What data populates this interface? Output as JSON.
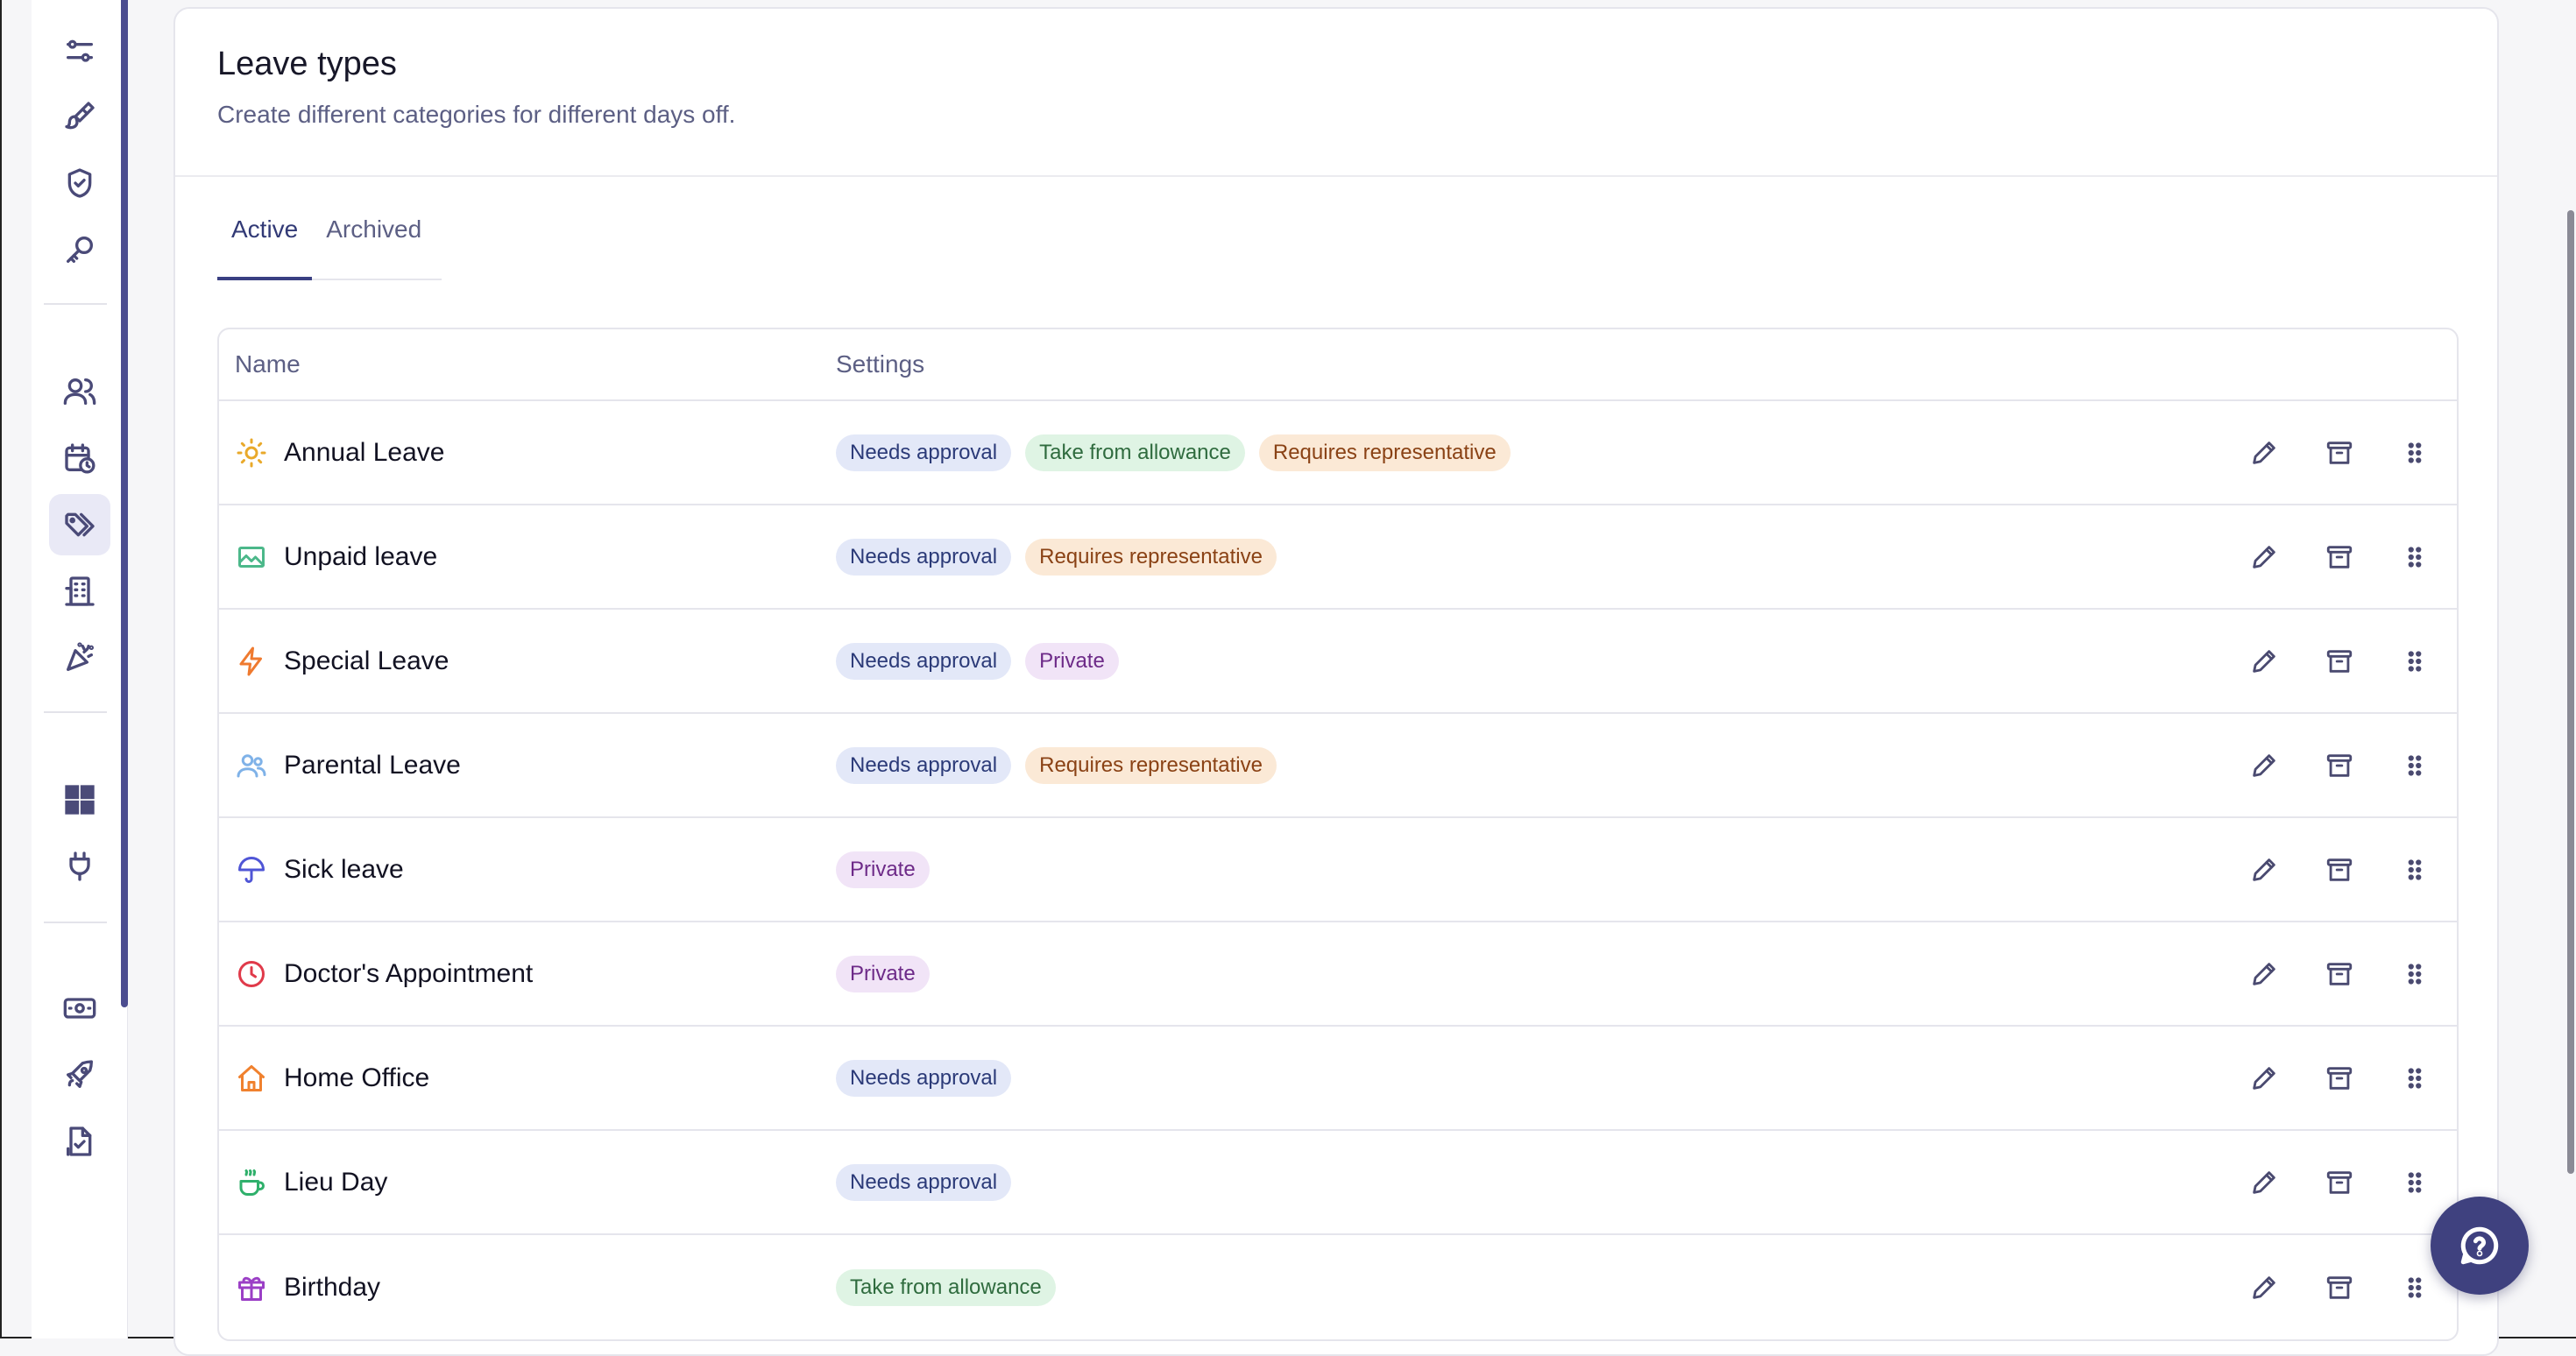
{
  "header": {
    "title": "Leave types",
    "subtitle": "Create different categories for different days off."
  },
  "tabs": [
    {
      "label": "Active",
      "active": true
    },
    {
      "label": "Archived",
      "active": false
    }
  ],
  "table": {
    "columns": {
      "name": "Name",
      "settings": "Settings"
    },
    "rows": [
      {
        "name": "Annual Leave",
        "icon": "sun-icon",
        "color": "#e9a92a",
        "badges": [
          "Needs approval",
          "Take from allowance",
          "Requires representative"
        ]
      },
      {
        "name": "Unpaid leave",
        "icon": "image-icon",
        "color": "#4cb88a",
        "badges": [
          "Needs approval",
          "Requires representative"
        ]
      },
      {
        "name": "Special Leave",
        "icon": "lightning-icon",
        "color": "#ef7a2f",
        "badges": [
          "Needs approval",
          "Private"
        ]
      },
      {
        "name": "Parental Leave",
        "icon": "people-icon",
        "color": "#7fb2e8",
        "badges": [
          "Needs approval",
          "Requires representative"
        ]
      },
      {
        "name": "Sick leave",
        "icon": "umbrella-icon",
        "color": "#4f55d6",
        "badges": [
          "Private"
        ]
      },
      {
        "name": "Doctor's Appointment",
        "icon": "clock-icon",
        "color": "#e03a4a",
        "badges": [
          "Private"
        ]
      },
      {
        "name": "Home Office",
        "icon": "house-icon",
        "color": "#f0812e",
        "badges": [
          "Needs approval"
        ]
      },
      {
        "name": "Lieu Day",
        "icon": "coffee-cup-icon",
        "color": "#2fb06b",
        "badges": [
          "Needs approval"
        ]
      },
      {
        "name": "Birthday",
        "icon": "gift-icon",
        "color": "#9b3fc6",
        "badges": [
          "Take from allowance"
        ]
      }
    ]
  },
  "badge_styles": {
    "Needs approval": "approval",
    "Take from allowance": "allowance",
    "Requires representative": "representative",
    "Private": "private"
  },
  "sidebar": {
    "items": [
      {
        "icon": "sliders-icon"
      },
      {
        "icon": "paintbrush-icon"
      },
      {
        "icon": "shield-check-icon"
      },
      {
        "icon": "key-icon"
      },
      {
        "icon": "users-icon"
      },
      {
        "icon": "calendar-clock-icon"
      },
      {
        "icon": "tags-icon",
        "active": true
      },
      {
        "icon": "building-icon"
      },
      {
        "icon": "party-popper-icon"
      },
      {
        "icon": "windows-grid-icon"
      },
      {
        "icon": "plug-icon"
      },
      {
        "icon": "money-icon"
      },
      {
        "icon": "rocket-icon"
      },
      {
        "icon": "file-check-icon"
      }
    ]
  },
  "colors": {
    "accent": "#3f417f",
    "sidebar_accent": "#4b4c8f"
  }
}
